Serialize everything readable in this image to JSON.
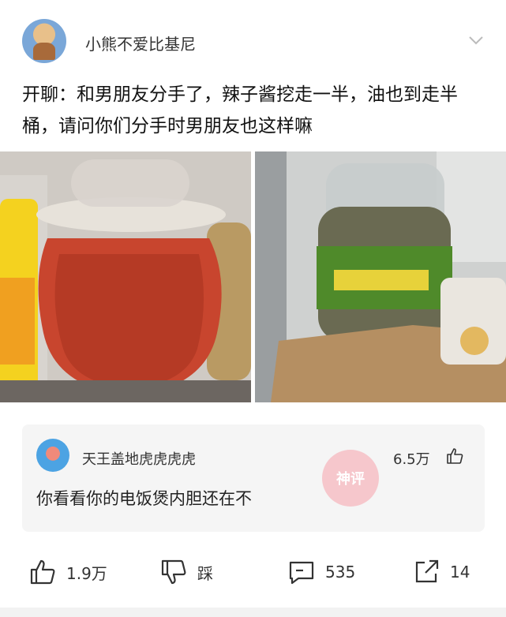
{
  "post": {
    "username": "小熊不爱比基尼",
    "text": "开聊：和男朋友分手了，辣子酱挖走一半，油也到走半桶，请问你们分手时男朋友也这样嘛"
  },
  "comment": {
    "username": "天王盖地虎虎虎虎",
    "likes": "6.5万",
    "text": "你看看你的电饭煲内胆还在不",
    "stamp_label": "神评"
  },
  "actions": {
    "like_count": "1.9万",
    "dislike_label": "踩",
    "comment_count": "535",
    "share_count": "14"
  },
  "icons": [
    "chevron-down-icon",
    "thumbs-up-icon",
    "thumbs-down-icon",
    "comment-icon",
    "share-icon"
  ]
}
